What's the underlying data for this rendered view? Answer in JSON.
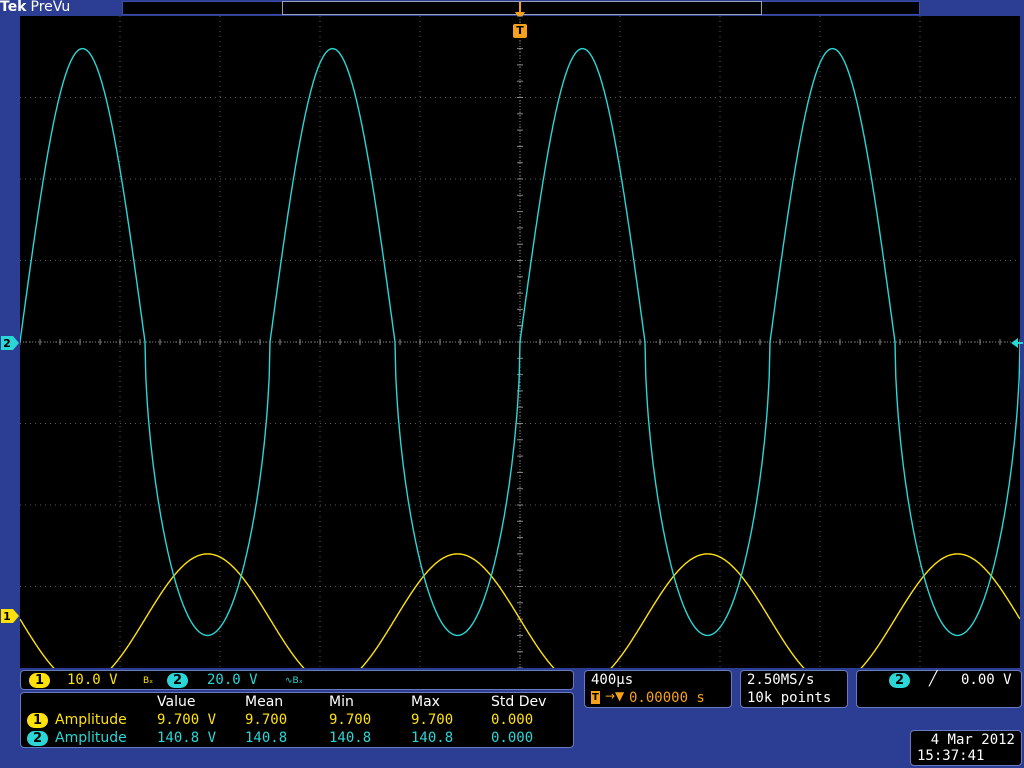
{
  "brand": {
    "logo": "Tek",
    "mode": "PreVu"
  },
  "trigger_marker": "T",
  "channels": [
    {
      "id": "1",
      "color": "#ffe20c",
      "scale": "10.0 V",
      "coupling_icon": "bandwidth-limit-icon"
    },
    {
      "id": "2",
      "color": "#2ad6d6",
      "scale": "20.0 V",
      "coupling_icon": "ac-coupling-bandwidth-icon"
    }
  ],
  "ch_panel": {
    "ch1_badge": "1",
    "ch1_scale": "10.0 V",
    "ch1_bw": "Bₓ",
    "ch2_badge": "2",
    "ch2_scale": "20.0 V",
    "ch2_bw": "∿Bₓ"
  },
  "timebase": {
    "scale": "400µs",
    "trigger_pos": "0.00000 s",
    "trigger_symbol": "T→▼"
  },
  "acquisition": {
    "rate": "2.50MS/s",
    "record": "10k points"
  },
  "trigger": {
    "source": "2",
    "slope_icon": "rising-edge-icon",
    "slope_glyph": "╱",
    "level": "0.00 V"
  },
  "measurements": {
    "headers": [
      "Value",
      "Mean",
      "Min",
      "Max",
      "Std Dev"
    ],
    "rows": [
      {
        "channel": "1",
        "name": "Amplitude",
        "value": "9.700 V",
        "mean": "9.700",
        "min": "9.700",
        "max": "9.700",
        "std": "0.000"
      },
      {
        "channel": "2",
        "name": "Amplitude",
        "value": "140.8 V",
        "mean": "140.8",
        "min": "140.8",
        "max": "140.8",
        "std": "0.000"
      }
    ]
  },
  "datetime": {
    "date": "4 Mar 2012",
    "time": "15:37:41"
  },
  "chart_data": {
    "type": "line",
    "title": "",
    "xlabel": "",
    "ylabel": "",
    "divisions": {
      "x": 10,
      "y": 8
    },
    "series": [
      {
        "name": "1",
        "color": "#ffe20c",
        "shape": "sine",
        "cycles": 4,
        "amplitude_divs": 0.8,
        "offset_divs": -3.4,
        "phase_start": "falling"
      },
      {
        "name": "2",
        "color": "#2ad6d6",
        "shape": "flattened-sine",
        "cycles": 4,
        "amplitude_divs": 3.6,
        "offset_divs": 0,
        "phase_start": "rising"
      }
    ]
  }
}
